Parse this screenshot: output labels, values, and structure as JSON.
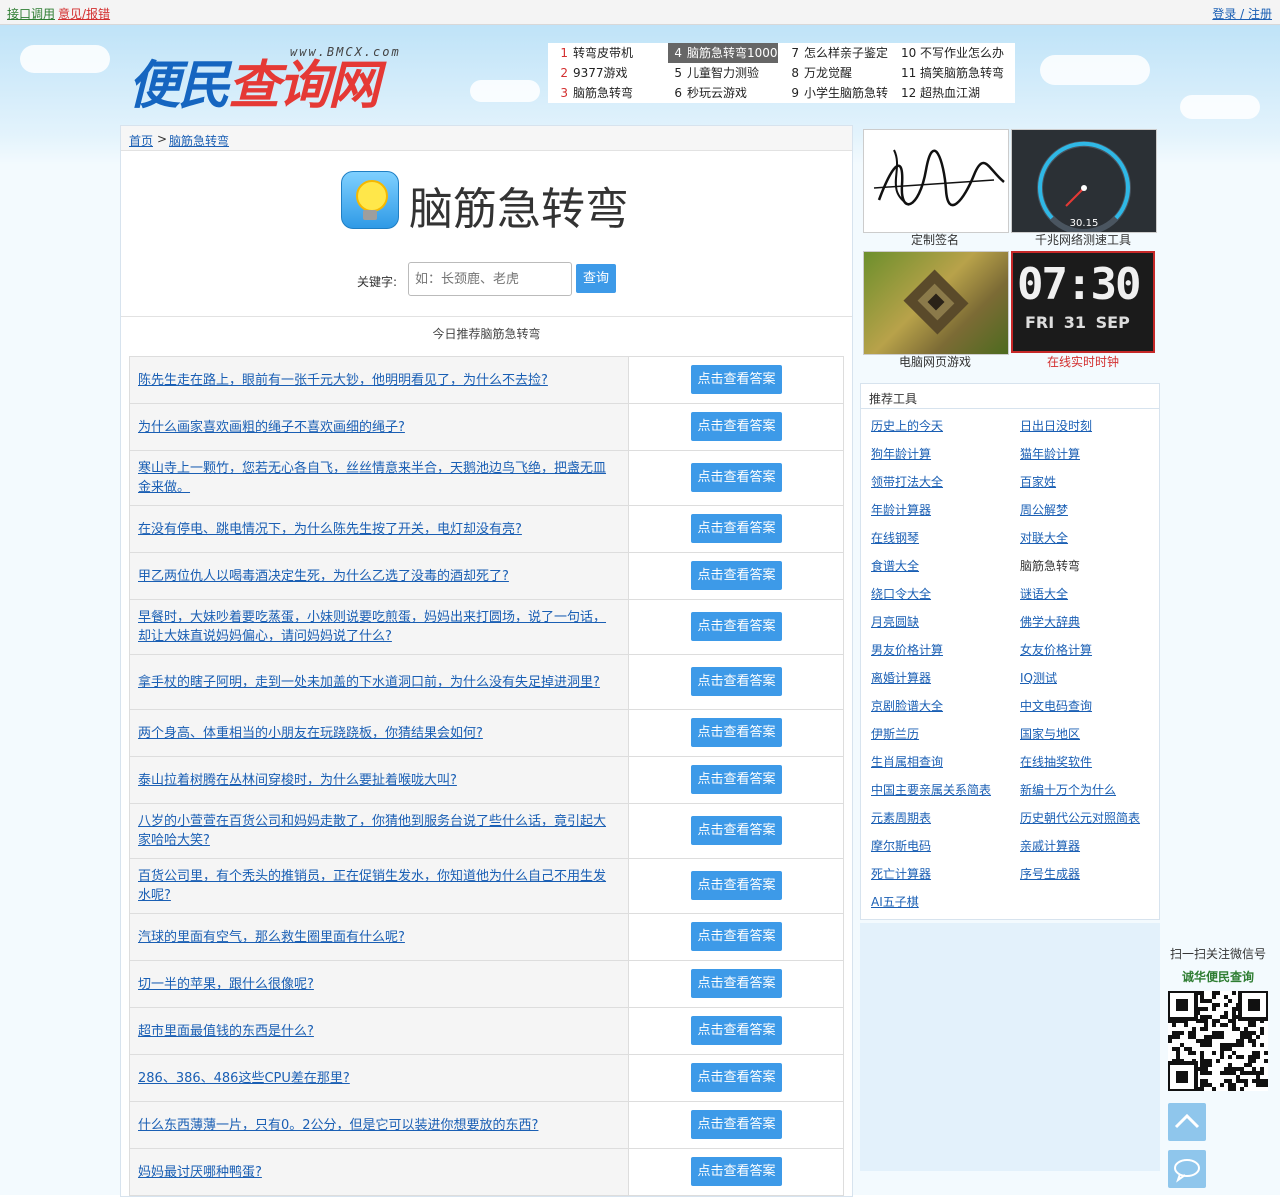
{
  "topbar": {
    "api": "接口调用",
    "feedback": "意见/报错",
    "login": "登录 / 注册"
  },
  "logo": {
    "text_a": "便民",
    "text_b": "查询网",
    "url": "www.BMCX.com"
  },
  "hot": [
    {
      "n": "1",
      "t": "转弯皮带机"
    },
    {
      "n": "2",
      "t": "9377游戏"
    },
    {
      "n": "3",
      "t": "脑筋急转弯"
    },
    {
      "n": "4",
      "t": "脑筋急转弯1000"
    },
    {
      "n": "5",
      "t": "儿童智力测验"
    },
    {
      "n": "6",
      "t": "秒玩云游戏"
    },
    {
      "n": "7",
      "t": "怎么样亲子鉴定"
    },
    {
      "n": "8",
      "t": "万龙觉醒"
    },
    {
      "n": "9",
      "t": "小学生脑筋急转"
    },
    {
      "n": "10",
      "t": "不写作业怎么办"
    },
    {
      "n": "11",
      "t": "搞笑脑筋急转弯"
    },
    {
      "n": "12",
      "t": "超热血江湖"
    }
  ],
  "breadcrumb": {
    "home": "首页",
    "sep": ">",
    "current": "脑筋急转弯"
  },
  "page_title": "脑筋急转弯",
  "search": {
    "label": "关键字:",
    "placeholder": "如：长颈鹿、老虎",
    "button": "查询"
  },
  "rec_heading": "今日推荐脑筋急转弯",
  "answer_label": "点击查看答案",
  "questions": [
    "陈先生走在路上，眼前有一张千元大钞，他明明看见了，为什么不去捡?",
    "为什么画家喜欢画粗的绳子不喜欢画细的绳子?",
    "寒山寺上一颗竹，您若无心各自飞，丝丝情意来半合，天鹅池边鸟飞绝，把盏无皿金来做。",
    "在没有停电、跳电情况下，为什么陈先生按了开关，电灯却没有亮?",
    "甲乙两位仇人以喝毒酒决定生死，为什么乙选了没毒的酒却死了?",
    "早餐时，大妹吵着要吃蒸蛋，小妹则说要吃煎蛋，妈妈出来打圆场，说了一句话，却让大妹直说妈妈偏心，请问妈妈说了什么?",
    "拿手杖的瞎子阿明，走到一处未加盖的下水道洞口前，为什么没有失足掉进洞里?",
    "两个身高、体重相当的小朋友在玩跷跷板，你猜结果会如何?",
    "泰山拉着树腾在丛林间穿梭时，为什么要扯着喉咙大叫?",
    "八岁的小萱萱在百货公司和妈妈走散了，你猜他到服务台说了些什么话，竟引起大家哈哈大笑?",
    "百货公司里，有个秃头的推销员，正在促销生发水，你知道他为什么自己不用生发水呢?",
    "汽球的里面有空气，那么救生圈里面有什么呢?",
    "切一半的苹果，跟什么很像呢?",
    "超市里面最值钱的东西是什么?",
    "286、386、486这些CPU差在那里?",
    "什么东西薄薄一片，只有0。2公分，但是它可以装进你想要放的东西?",
    "妈妈最讨厌哪种鸭蛋?"
  ],
  "side_tiles": [
    {
      "caption": "定制签名"
    },
    {
      "caption": "千兆网络测速工具",
      "gauge_reading": "30.15"
    },
    {
      "caption": "电脑网页游戏"
    },
    {
      "caption": "在线实时时钟",
      "time": "07:30",
      "day": "FRI",
      "date": "31",
      "month": "SEP"
    }
  ],
  "tools": {
    "title": "推荐工具",
    "items": [
      "历史上的今天",
      "日出日没时刻",
      "狗年龄计算",
      "猫年龄计算",
      "领带打法大全",
      "百家姓",
      "年龄计算器",
      "周公解梦",
      "在线钢琴",
      "对联大全",
      "食谱大全",
      "脑筋急转弯",
      "绕口令大全",
      "谜语大全",
      "月亮圆缺",
      "佛学大辞典",
      "男友价格计算",
      "女友价格计算",
      "离婚计算器",
      "IQ测试",
      "京剧脸谱大全",
      "中文电码查询",
      "伊斯兰历",
      "国家与地区",
      "生肖属相查询",
      "在线抽奖软件",
      "中国主要亲属关系简表",
      "新编十万个为什么",
      "元素周期表",
      "历史朝代公元对照简表",
      "摩尔斯电码",
      "亲戚计算器",
      "死亡计算器",
      "序号生成器",
      "AI五子棋"
    ]
  },
  "wechat": {
    "line1": "扫一扫关注微信号",
    "line2": "诚华便民查询"
  },
  "colors": {
    "link": "#1a5fb4",
    "button": "#3d9ae8",
    "accent_red": "#d32f2f"
  }
}
